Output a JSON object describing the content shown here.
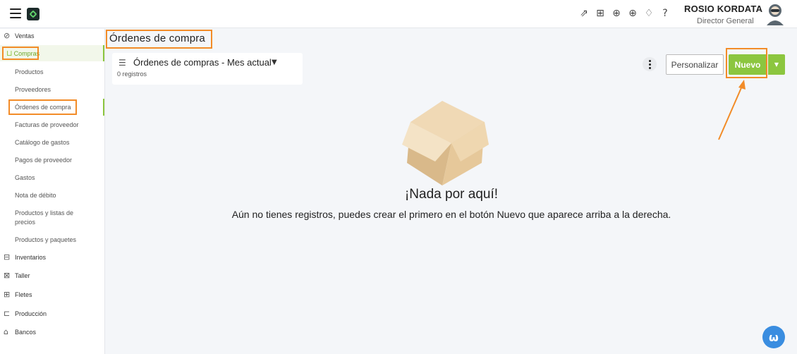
{
  "header": {
    "user_name": "ROSIO KORDATA",
    "user_role": "Director General",
    "icons": [
      "external-link-icon",
      "gift-icon",
      "zoom-icon",
      "plus-circle-icon",
      "bell-icon",
      "help-icon"
    ]
  },
  "sidebar": {
    "ventas": "Ventas",
    "compras": "Compras",
    "compras_sub": [
      "Productos",
      "Proveedores",
      "Órdenes de compra",
      "Facturas de proveedor",
      "Catálogo de gastos",
      "Pagos de proveedor",
      "Gastos",
      "Nota de débito",
      "Productos y listas de",
      "precios",
      "Productos y paquetes"
    ],
    "inventarios": "Inventarios",
    "taller": "Taller",
    "fletes": "Fletes",
    "produccion": "Producción",
    "bancos": "Bancos"
  },
  "main": {
    "page_title": "Órdenes de compra",
    "view_name": "Órdenes de compras - Mes actual",
    "record_count": "0 registros",
    "personalizar": "Personalizar",
    "nuevo": "Nuevo",
    "empty_title": "¡Nada por aquí!",
    "empty_message": "Aún no tienes registros, puedes crear el primero en el botón Nuevo que aparece arriba a la derecha."
  },
  "colors": {
    "accent_green": "#8cc63f",
    "highlight_orange": "#f28c28",
    "chat_blue": "#3a8de0"
  }
}
